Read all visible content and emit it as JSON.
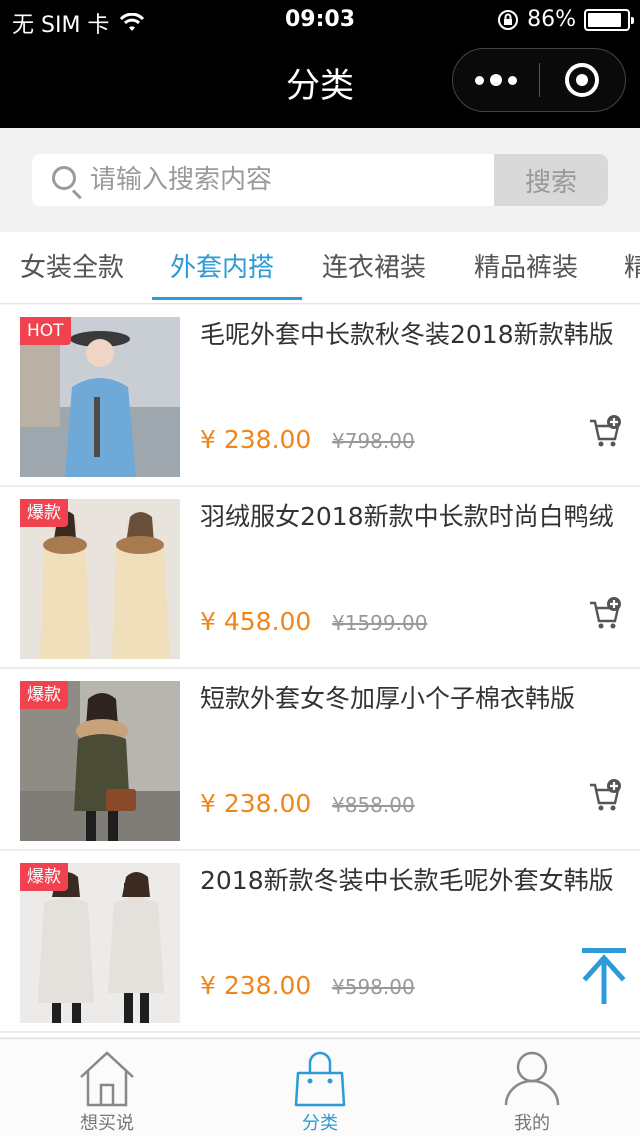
{
  "status_bar": {
    "carrier": "无 SIM 卡",
    "time": "09:03",
    "battery_text": "86%",
    "battery_level": 0.86
  },
  "nav": {
    "title": "分类"
  },
  "search": {
    "placeholder": "请输入搜索内容",
    "button_label": "搜索"
  },
  "tabs": [
    {
      "label": "女装全款",
      "active": false
    },
    {
      "label": "外套内搭",
      "active": true
    },
    {
      "label": "连衣裙装",
      "active": false
    },
    {
      "label": "精品裤装",
      "active": false
    },
    {
      "label": "精",
      "active": false
    }
  ],
  "products": [
    {
      "badge": "HOT",
      "title": "毛呢外套中长款秋冬装2018新款韩版",
      "price": "¥ 238.00",
      "original_price": "¥798.00"
    },
    {
      "badge": "爆款",
      "title": "羽绒服女2018新款中长款时尚白鸭绒",
      "price": "¥ 458.00",
      "original_price": "¥1599.00"
    },
    {
      "badge": "爆款",
      "title": "短款外套女冬加厚小个子棉衣韩版",
      "price": "¥ 238.00",
      "original_price": "¥858.00"
    },
    {
      "badge": "爆款",
      "title": "2018新款冬装中长款毛呢外套女韩版",
      "price": "¥ 238.00",
      "original_price": "¥598.00"
    }
  ],
  "tab_bar": [
    {
      "label": "想买说",
      "icon": "house-icon",
      "active": false
    },
    {
      "label": "分类",
      "icon": "shopping-bag-icon",
      "active": true
    },
    {
      "label": "我的",
      "icon": "user-icon",
      "active": false
    }
  ],
  "colors": {
    "accent": "#2c9bd6",
    "price": "#f08519",
    "badge": "#f0424f"
  }
}
